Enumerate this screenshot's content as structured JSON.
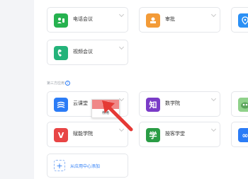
{
  "apps_row1": [
    {
      "label": "电话会议",
      "icon": "phone-conference-icon",
      "color": "#26b24f"
    },
    {
      "label": "审批",
      "icon": "approval-stamp-icon",
      "color": "#f39b38"
    },
    {
      "label": "",
      "icon": "location-pin-icon",
      "color": "#2b90f5"
    }
  ],
  "apps_row2": [
    {
      "label": "视频会议",
      "icon": "video-call-icon",
      "color": "#24b37a"
    }
  ],
  "third_party": {
    "section_label": "第三方应用",
    "help_symbol": "?"
  },
  "apps_row3": [
    {
      "label": "云课堂",
      "icon": "cloud-class-icon",
      "color": "#2b7cf6",
      "glyph": "≋"
    },
    {
      "label": "数学院",
      "icon": "zhi-icon",
      "color": "#7a3cc7",
      "glyph": "知"
    },
    {
      "label": "",
      "icon": "cartoon-icon",
      "color": "#5aa35a",
      "glyph": ""
    }
  ],
  "apps_row4": [
    {
      "label": "赋能学院",
      "icon": "v-icon",
      "color": "#e84545",
      "glyph": "V"
    },
    {
      "label": "按客学堂",
      "icon": "xue-icon",
      "color": "#2a9c45",
      "glyph": "学"
    },
    {
      "label": "",
      "icon": "infinity-icon",
      "color": "#2b7cf6",
      "glyph": "∞"
    }
  ],
  "context_menu": {
    "items": [
      "设置",
      "停用"
    ]
  },
  "add_from_center": "从应用中心添加",
  "colors": {
    "accent": "#2b7cf6",
    "arrow": "#e53935",
    "menu_highlight": "#f08888"
  }
}
